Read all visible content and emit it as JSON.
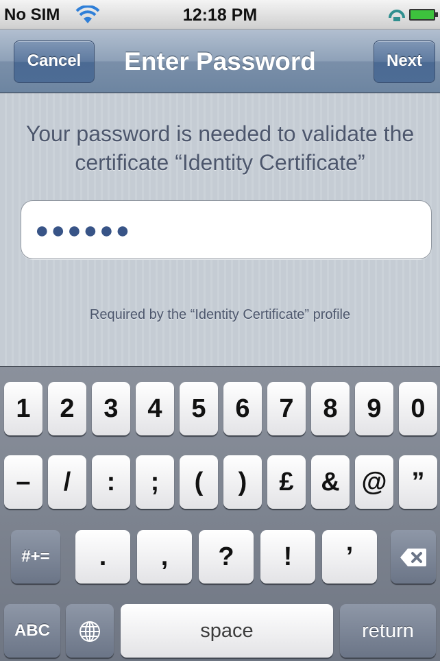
{
  "status_bar": {
    "carrier": "No SIM",
    "time": "12:18 PM",
    "wifi_icon": "wifi-icon",
    "sync_icon": "sync-icon",
    "battery_icon": "battery-icon",
    "battery_color": "#3dc23d"
  },
  "nav": {
    "title": "Enter Password",
    "cancel_label": "Cancel",
    "next_label": "Next"
  },
  "content": {
    "message": "Your password is needed to validate the certificate “Identity Certificate”",
    "password_value": "●●●●●●",
    "footnote": "Required by the “Identity Certificate” profile"
  },
  "keyboard": {
    "row1": [
      "1",
      "2",
      "3",
      "4",
      "5",
      "6",
      "7",
      "8",
      "9",
      "0"
    ],
    "row2": [
      "–",
      "/",
      ":",
      ";",
      "(",
      ")",
      "£",
      "&",
      "@",
      "”"
    ],
    "row3": [
      ".",
      ",",
      "?",
      "!",
      "’"
    ],
    "symbols_label": "#+=",
    "abc_label": "ABC",
    "globe_icon": "globe-icon",
    "delete_icon": "backspace-icon",
    "space_label": "space",
    "return_label": "return"
  },
  "colors": {
    "nav_bar": "#7a8fa9",
    "background": "#c5ccd4",
    "keyboard": "#7d8490",
    "text_muted": "#4c566c"
  }
}
